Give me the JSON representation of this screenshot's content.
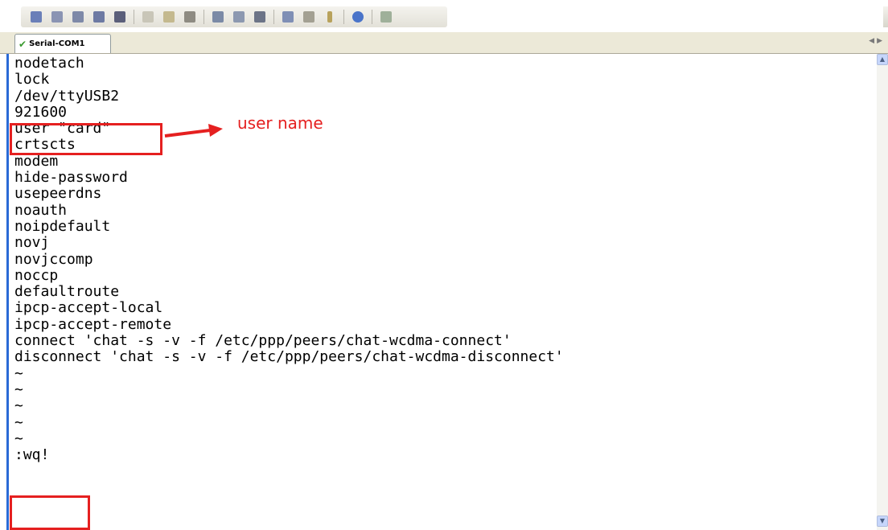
{
  "tab": {
    "label": "Serial-COM1"
  },
  "terminal": {
    "lines": [
      "nodetach",
      "lock",
      "/dev/ttyUSB2",
      "921600",
      "user \"card\"",
      "crtscts",
      "modem",
      "hide-password",
      "usepeerdns",
      "noauth",
      "noipdefault",
      "novj",
      "novjccomp",
      "noccp",
      "defaultroute",
      "ipcp-accept-local",
      "ipcp-accept-remote",
      "connect 'chat -s -v -f /etc/ppp/peers/chat-wcdma-connect'",
      "disconnect 'chat -s -v -f /etc/ppp/peers/chat-wcdma-disconnect'",
      "~",
      "~",
      "~",
      "~",
      "~",
      ":wq!"
    ]
  },
  "annotation": {
    "label": "user name",
    "color": "#e52020"
  },
  "toolbar": {
    "icons": [
      "connect-icon",
      "disconnect-icon",
      "reconnect-icon",
      "session-icon",
      "close-session-icon",
      "copy-icon",
      "paste-icon",
      "find-icon",
      "print-setup-icon",
      "print-preview-icon",
      "print-icon",
      "settings-icon",
      "options-icon",
      "key-icon",
      "help-icon",
      "map-icon"
    ]
  }
}
